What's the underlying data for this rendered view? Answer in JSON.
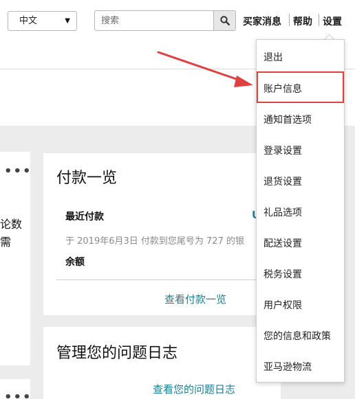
{
  "header": {
    "language": {
      "selected": "中文"
    },
    "search": {
      "placeholder": "搜索"
    },
    "nav": {
      "buyer_messages": "买家消息",
      "help": "帮助",
      "settings": "设置"
    }
  },
  "settings_menu": {
    "items": [
      "退出",
      "账户信息",
      "通知首选项",
      "登录设置",
      "退货设置",
      "礼品选项",
      "配送设置",
      "税务设置",
      "用户权限",
      "您的信息和政策",
      "亚马逊物流"
    ],
    "highlighted": "账户信息",
    "highlight_color": "#e04040"
  },
  "left_card": {
    "more": "•••",
    "text_line1": "论数",
    "text_line2": "需"
  },
  "payments_card": {
    "title": "付款一览",
    "recent_label": "最近付款",
    "recent_note": "于 2019年6月3日 付款到您尾号为 727 的银",
    "balance_label": "余额",
    "link": "查看付款一览",
    "right_fragment": "U"
  },
  "issues_card": {
    "title": "管理您的问题日志",
    "link": "查看您的问题日志"
  },
  "colors": {
    "link": "#1a7f9c",
    "background_grey": "#ececec"
  }
}
